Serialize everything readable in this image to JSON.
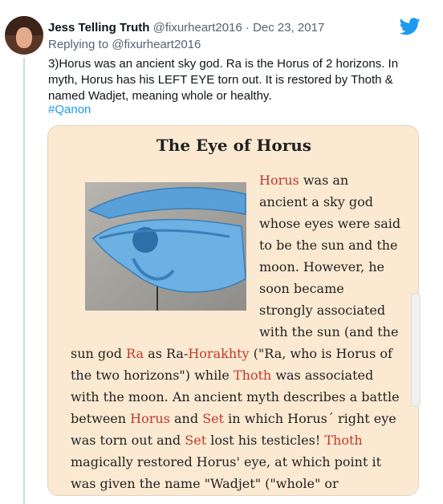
{
  "tweet": {
    "author_name": "Jess Telling Truth",
    "handle": "@fixurheart2016",
    "separator": "·",
    "date": "Dec 23, 2017",
    "replying_prefix": "Replying to",
    "replying_handle": "@fixurheart2016",
    "text": "3)Horus was an ancient sky god. Ra is the Horus of 2 horizons. In myth, Horus has his LEFT EYE torn out. It is restored by Thoth & named Wadjet, meaning whole or healthy.",
    "hashtag": "#Qanon"
  },
  "card": {
    "title": "The Eye of Horus",
    "lines": [
      [
        {
          "t": "Horus",
          "r": true
        },
        {
          "t": " was an",
          "r": false
        }
      ],
      [
        {
          "t": "ancient a sky god",
          "r": false
        }
      ],
      [
        {
          "t": "whose eyes were said",
          "r": false
        }
      ],
      [
        {
          "t": "to be the sun and the",
          "r": false
        }
      ],
      [
        {
          "t": "moon. However, he",
          "r": false
        }
      ],
      [
        {
          "t": "soon became",
          "r": false
        }
      ],
      [
        {
          "t": "strongly associated",
          "r": false
        }
      ],
      [
        {
          "t": "with the sun (and the",
          "r": false
        }
      ],
      [
        {
          "t": "sun god ",
          "r": false
        },
        {
          "t": "Ra",
          "r": true
        },
        {
          "t": " as Ra-",
          "r": false
        },
        {
          "t": "Horakhty",
          "r": true
        },
        {
          "t": " (\"Ra, who is Horus of",
          "r": false
        }
      ],
      [
        {
          "t": "the two horizons\") while ",
          "r": false
        },
        {
          "t": "Thoth",
          "r": true
        },
        {
          "t": " was associated",
          "r": false
        }
      ],
      [
        {
          "t": "with the moon. An ancient myth describes a battle",
          "r": false
        }
      ],
      [
        {
          "t": "between ",
          "r": false
        },
        {
          "t": "Horus",
          "r": true
        },
        {
          "t": " and ",
          "r": false
        },
        {
          "t": "Set",
          "r": true
        },
        {
          "t": " in which Horus´ right eye",
          "r": false
        }
      ],
      [
        {
          "t": "was torn out and ",
          "r": false
        },
        {
          "t": "Set",
          "r": true
        },
        {
          "t": " lost his testicles! ",
          "r": false
        },
        {
          "t": "Thoth",
          "r": true
        }
      ],
      [
        {
          "t": "magically restored Horus' eye, at which point it",
          "r": false
        }
      ],
      [
        {
          "t": "was given the name \"Wadjet\" (\"whole\" or",
          "r": false
        }
      ]
    ]
  },
  "colors": {
    "link": "#1d9bf0",
    "muted": "#536471",
    "card_bg": "#fbe9d1",
    "article_red": "#c0392b"
  }
}
